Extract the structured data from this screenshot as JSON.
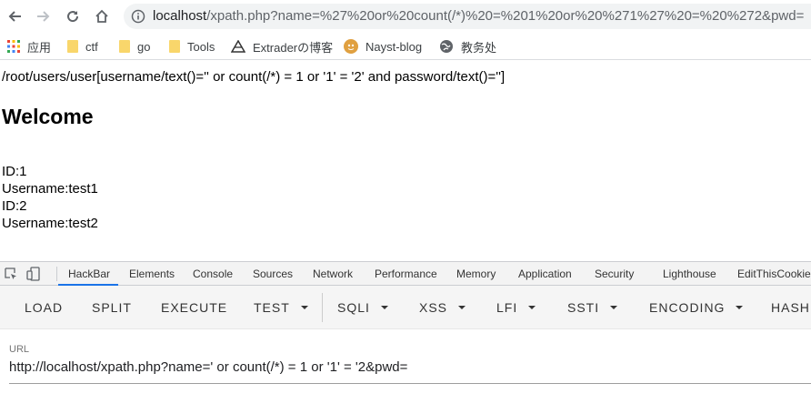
{
  "browser": {
    "url_host": "localhost",
    "url_rest": "/xpath.php?name=%27%20or%20count(/*)%20=%201%20or%20%271%27%20=%20%272&pwd="
  },
  "bookmarks": [
    {
      "label": "应用",
      "icon": "apps-grid-icon"
    },
    {
      "label": "ctf",
      "icon": "folder-icon"
    },
    {
      "label": "go",
      "icon": "folder-icon"
    },
    {
      "label": "Tools",
      "icon": "folder-icon"
    },
    {
      "label": "Extraderの博客",
      "icon": "extrader-logo-icon"
    },
    {
      "label": "Nayst-blog",
      "icon": "nayst-avatar-icon"
    },
    {
      "label": "教务处",
      "icon": "globe-icon"
    }
  ],
  "page": {
    "query": "/root/users/user[username/text()='' or count(/*) = 1 or '1' = '2' and password/text()='']",
    "welcome": "Welcome",
    "results": [
      "ID:1",
      "Username:test1",
      "ID:2",
      "Username:test2"
    ]
  },
  "devtools": {
    "tabs": [
      "HackBar",
      "Elements",
      "Console",
      "Sources",
      "Network",
      "Performance",
      "Memory",
      "Application",
      "Security",
      "Lighthouse",
      "EditThisCookie"
    ],
    "active_tab": "HackBar"
  },
  "hackbar": {
    "buttons": [
      {
        "label": "LOAD",
        "dropdown": false
      },
      {
        "label": "SPLIT",
        "dropdown": false
      },
      {
        "label": "EXECUTE",
        "dropdown": false
      },
      {
        "label": "TEST",
        "dropdown": true
      },
      {
        "label": "SQLI",
        "dropdown": true
      },
      {
        "label": "XSS",
        "dropdown": true
      },
      {
        "label": "LFI",
        "dropdown": true
      },
      {
        "label": "SSTI",
        "dropdown": true
      },
      {
        "label": "ENCODING",
        "dropdown": true
      },
      {
        "label": "HASH",
        "dropdown": false
      }
    ],
    "url_label": "URL",
    "url_value": "http://localhost/xpath.php?name=' or count(/*) = 1 or '1' = '2&pwd="
  },
  "colors": {
    "accent": "#1a73e8",
    "omnibox_bg": "#f1f3f4",
    "devtools_bg": "#f3f3f3"
  }
}
